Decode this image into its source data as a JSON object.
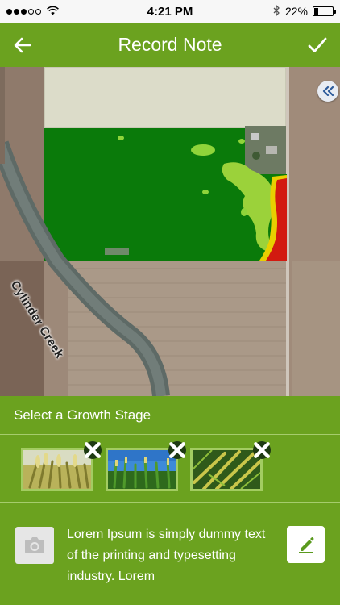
{
  "status_bar": {
    "time": "4:21 PM",
    "battery": "22%",
    "battery_level": 0.22,
    "signal_bars_filled": 3,
    "signal_bars_total": 5
  },
  "nav": {
    "title": "Record Note",
    "back_icon": "arrow-left-icon",
    "done_icon": "checkmark-icon"
  },
  "map": {
    "road_label": "Cylinder Creek",
    "collapse_icon": "double-chevron-left-icon"
  },
  "growth_stage": {
    "header": "Select a Growth Stage",
    "items": [
      {
        "image": "wheat-heads-photo",
        "remove_icon": "close-icon"
      },
      {
        "image": "corn-field-photo",
        "remove_icon": "close-icon"
      },
      {
        "image": "corn-stalks-photo",
        "remove_icon": "close-icon"
      }
    ]
  },
  "note": {
    "text": "Lorem Ipsum is simply dummy text of the printing and typesetting industry. Lorem",
    "camera_icon": "camera-icon",
    "edit_icon": "pencil-icon"
  },
  "colors": {
    "brand_green": "#6ba21f",
    "field_green": "#0a7a0a",
    "stress_yellow": "#e8d000",
    "stress_red": "#d21a10",
    "light_green": "#9bd23a"
  }
}
